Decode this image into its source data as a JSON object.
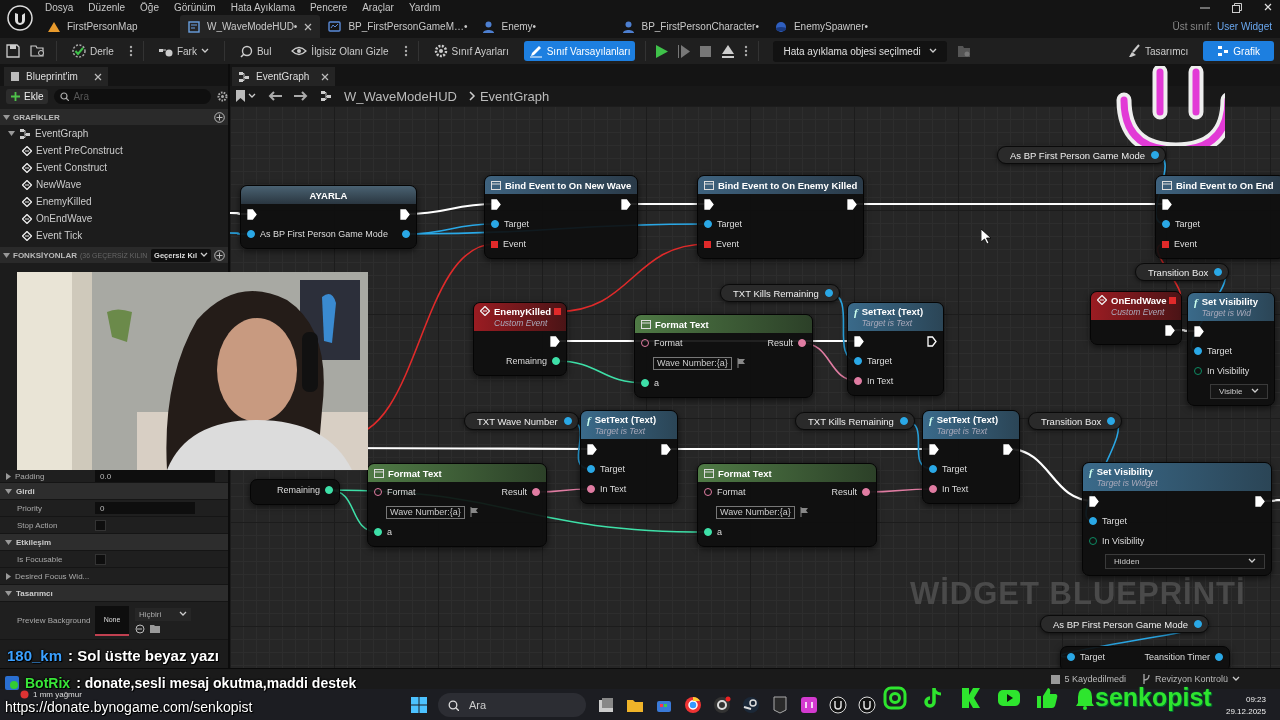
{
  "menu": [
    "Dosya",
    "Düzenle",
    "Öğe",
    "Görünüm",
    "Hata Ayıklama",
    "Pencere",
    "Araçlar",
    "Yardım"
  ],
  "tabs": [
    {
      "label": "FirstPersonMap",
      "kind": "map",
      "selected": false
    },
    {
      "label": "W_WaveModeHUD•",
      "kind": "widget",
      "selected": true
    },
    {
      "label": "BP_FirstPersonGameM…•",
      "kind": "blueprint",
      "selected": false
    },
    {
      "label": "Enemy•",
      "kind": "actor",
      "selected": false
    },
    {
      "label": "BP_FirstPersonCharacter•",
      "kind": "actor",
      "selected": false
    },
    {
      "label": "EnemySpawner•",
      "kind": "sphere",
      "selected": false
    }
  ],
  "parent_class": {
    "label": "Üst sınıf:",
    "value": "User Widget"
  },
  "toolbar": [
    {
      "label": "Derle",
      "active": false
    },
    {
      "label": "Fark",
      "active": false,
      "dropdown": true
    },
    {
      "label": "Bul",
      "active": false
    },
    {
      "label": "İlgisiz Olanı Gizle",
      "active": false
    },
    {
      "label": "Sınıf Ayarları",
      "active": false
    },
    {
      "label": "Sınıf Varsayılanları",
      "active": true
    }
  ],
  "debug_object": "Hata ayıklama objesi seçilmedi",
  "mode_buttons": [
    {
      "label": "Tasarımcı",
      "selected": false
    },
    {
      "label": "Grafik",
      "selected": true
    }
  ],
  "sidebar": {
    "tab": "Blueprint'im",
    "add_button": "Ekle",
    "search_placeholder": "Ara",
    "graphs_header": "GRAFİKLER",
    "tree": [
      {
        "label": "EventGraph",
        "expanded": true,
        "children": [
          {
            "label": "Event PreConstruct"
          },
          {
            "label": "Event Construct"
          },
          {
            "label": "NewWave"
          },
          {
            "label": "EnemyKilled"
          },
          {
            "label": "OnEndWave"
          },
          {
            "label": "Event Tick"
          }
        ]
      }
    ],
    "functions_header": "FONKSİYONLAR",
    "functions_note": "(36 GEÇERSİZ KILIN",
    "override_dropdown": "Geçersiz Kıl"
  },
  "details": [
    {
      "kind": "group",
      "label": "Padding",
      "value": "0.0",
      "expanded": false
    },
    {
      "kind": "category",
      "label": "Girdi",
      "expanded": true
    },
    {
      "kind": "property",
      "label": "Priority",
      "value": "0"
    },
    {
      "kind": "checkbox",
      "label": "Stop Action",
      "checked": false
    },
    {
      "kind": "category",
      "label": "Etkileşim",
      "expanded": true
    },
    {
      "kind": "checkbox",
      "label": "Is Focusable",
      "checked": false
    },
    {
      "kind": "group",
      "label": "Desired Focus Wid...",
      "expanded": false
    },
    {
      "kind": "category",
      "label": "Tasarımcı",
      "expanded": true
    },
    {
      "kind": "color",
      "label": "Preview Background",
      "swatch": "None",
      "dropdown": "Hiçbiri"
    }
  ],
  "graph_tab": "EventGraph",
  "breadcrumb": [
    "W_WaveModeHUD",
    "EventGraph"
  ],
  "nodes": [
    {
      "kind": "setter",
      "title": "AYARLA",
      "rows": [
        {
          "in": {
            "kind": "exec",
            "linked": true
          },
          "out": {
            "kind": "exec",
            "linked": true
          }
        },
        {
          "in": {
            "kind": "object",
            "linked": true,
            "label": "As BP First Person Game Mode"
          },
          "out": {
            "kind": "object",
            "linked": true
          }
        }
      ]
    },
    {
      "kind": "call",
      "title": "Bind Event to On New Wave",
      "rows": [
        {
          "in": {
            "kind": "exec",
            "linked": true
          },
          "out": {
            "kind": "exec",
            "linked": true
          }
        },
        {
          "in": {
            "kind": "object",
            "linked": true,
            "label": "Target"
          }
        },
        {
          "in": {
            "kind": "delegate",
            "linked": true,
            "label": "Event"
          }
        }
      ]
    },
    {
      "kind": "call",
      "title": "Bind Event to On Enemy Killed",
      "rows": [
        {
          "in": {
            "kind": "exec",
            "linked": true
          },
          "out": {
            "kind": "exec",
            "linked": true
          }
        },
        {
          "in": {
            "kind": "object",
            "linked": true,
            "label": "Target"
          }
        },
        {
          "in": {
            "kind": "delegate",
            "linked": true,
            "label": "Event"
          }
        }
      ]
    },
    {
      "kind": "getter",
      "title": "As BP First Person Game Mode",
      "out": {
        "kind": "object",
        "linked": true
      }
    },
    {
      "kind": "call",
      "title": "Bind Event to On End",
      "rows": [
        {
          "in": {
            "kind": "exec",
            "linked": true
          }
        },
        {
          "in": {
            "kind": "object",
            "linked": true,
            "label": "Target"
          }
        },
        {
          "in": {
            "kind": "delegate",
            "linked": true,
            "label": "Event"
          }
        }
      ]
    },
    {
      "kind": "getter",
      "title": "Transition Box",
      "out": {
        "kind": "object",
        "linked": true
      }
    },
    {
      "kind": "event",
      "title": "OnEndWave",
      "subtitle": "Custom Event",
      "rows": [
        {
          "out": {
            "kind": "exec",
            "linked": true
          }
        }
      ]
    },
    {
      "kind": "function",
      "glyph": "f",
      "title": "Set Visibility",
      "subtitle": "Target is Wid",
      "rows": [
        {
          "in": {
            "kind": "exec",
            "linked": true
          }
        },
        {
          "in": {
            "kind": "object",
            "linked": true,
            "label": "Target"
          }
        },
        {
          "in": {
            "kind": "enum",
            "linked": false,
            "label": "In Visibility"
          }
        },
        {
          "dropdown": "Visible"
        }
      ]
    },
    {
      "kind": "event",
      "title": "EnemyKilled",
      "subtitle": "Custom Event",
      "rows": [
        {
          "out": {
            "kind": "exec",
            "linked": true
          }
        },
        {
          "out": {
            "kind": "int",
            "linked": true,
            "label": "Remainng"
          }
        }
      ]
    },
    {
      "kind": "getter",
      "title": "TXT Kills Remaining",
      "out": {
        "kind": "object",
        "linked": true
      }
    },
    {
      "kind": "format",
      "title": "Format Text",
      "rows": [
        {
          "in": {
            "kind": "text",
            "linked": false,
            "label": "Format"
          },
          "out": {
            "kind": "text",
            "linked": true,
            "label": "Result"
          }
        },
        {
          "field": "Wave Number:{a}"
        },
        {
          "in": {
            "kind": "int",
            "linked": true,
            "label": "a"
          }
        }
      ]
    },
    {
      "kind": "function",
      "glyph": "f",
      "title": "SetText (Text)",
      "subtitle": "Target is Text",
      "rows": [
        {
          "in": {
            "kind": "exec",
            "linked": true
          },
          "out": {
            "kind": "exec",
            "linked": false
          }
        },
        {
          "in": {
            "kind": "object",
            "linked": true,
            "label": "Target"
          }
        },
        {
          "in": {
            "kind": "text",
            "linked": true,
            "label": "In Text"
          }
        }
      ]
    },
    {
      "kind": "getter",
      "title": "TXT Wave Number",
      "out": {
        "kind": "object",
        "linked": true
      }
    },
    {
      "kind": "function",
      "glyph": "f",
      "title": "SetText (Text)",
      "subtitle": "Target is Text",
      "rows": [
        {
          "in": {
            "kind": "exec",
            "linked": true
          },
          "out": {
            "kind": "exec",
            "linked": true
          }
        },
        {
          "in": {
            "kind": "object",
            "linked": true,
            "label": "Target"
          }
        },
        {
          "in": {
            "kind": "text",
            "linked": true,
            "label": "In Text"
          }
        }
      ]
    },
    {
      "kind": "getter",
      "title": "TXT Kills Remaining",
      "out": {
        "kind": "object",
        "linked": true
      }
    },
    {
      "kind": "function",
      "glyph": "f",
      "title": "SetText (Text)",
      "subtitle": "Target is Text",
      "rows": [
        {
          "in": {
            "kind": "exec",
            "linked": true
          },
          "out": {
            "kind": "exec",
            "linked": true
          }
        },
        {
          "in": {
            "kind": "object",
            "linked": true,
            "label": "Target"
          }
        },
        {
          "in": {
            "kind": "text",
            "linked": true,
            "label": "In Text"
          }
        }
      ]
    },
    {
      "kind": "getter",
      "title": "Transition Box",
      "out": {
        "kind": "object",
        "linked": true
      }
    },
    {
      "kind": "format",
      "title": "Format Text",
      "rows": [
        {
          "in": {
            "kind": "text",
            "linked": false,
            "label": "Format"
          },
          "out": {
            "kind": "text",
            "linked": true,
            "label": "Result"
          }
        },
        {
          "field": "Wave Number:{a}"
        },
        {
          "in": {
            "kind": "int",
            "linked": true,
            "label": "a"
          }
        }
      ]
    },
    {
      "kind": "format",
      "title": "Format Text",
      "rows": [
        {
          "in": {
            "kind": "text",
            "linked": false,
            "label": "Format"
          },
          "out": {
            "kind": "text",
            "linked": true,
            "label": "Result"
          }
        },
        {
          "field": "Wave Number:{a}"
        },
        {
          "in": {
            "kind": "int",
            "linked": true,
            "label": "a"
          }
        }
      ]
    },
    {
      "kind": "function",
      "glyph": "f",
      "title": "Set Visibility",
      "subtitle": "Target is Widget",
      "rows": [
        {
          "in": {
            "kind": "exec",
            "linked": true
          },
          "out": {
            "kind": "exec",
            "linked": true
          }
        },
        {
          "in": {
            "kind": "object",
            "linked": true,
            "label": "Target"
          }
        },
        {
          "in": {
            "kind": "enum",
            "linked": false,
            "label": "In Visibility"
          }
        },
        {
          "dropdown": "Hidden"
        }
      ]
    },
    {
      "kind": "fragment",
      "rows": [
        {
          "out": {
            "kind": "int",
            "linked": true,
            "label": "Remaining"
          }
        }
      ]
    },
    {
      "kind": "getter",
      "title": "As BP First Person Game Mode",
      "out": {
        "kind": "object",
        "linked": true
      }
    },
    {
      "kind": "fragment",
      "rows": [
        {
          "in": {
            "kind": "object",
            "linked": true,
            "label": "Target"
          },
          "out": {
            "kind": "object",
            "linked": true,
            "label": "Teansition Timer"
          }
        }
      ]
    }
  ],
  "watermark": "WİDGET BLUEPRİNTİ",
  "status_bar": {
    "unsaved": "5 Kaydedilmedi",
    "revision": "Revizyon Kontrolü"
  },
  "webcam": {
    "kind": "picture"
  },
  "chat": [
    {
      "user": "180_km",
      "message": ": Sol üstte beyaz yazı"
    }
  ],
  "bot_message": {
    "user": "BotRix",
    "message": ": donate,sesli mesaj okutma,maddi destek"
  },
  "donate_url": "https://donate.bynogame.com/senkopist",
  "taskbar": {
    "weather": "1 mm yağmur",
    "search_placeholder": "Ara",
    "time": "09:23",
    "date": "29.12.2025"
  },
  "channel_name": "senkopist"
}
